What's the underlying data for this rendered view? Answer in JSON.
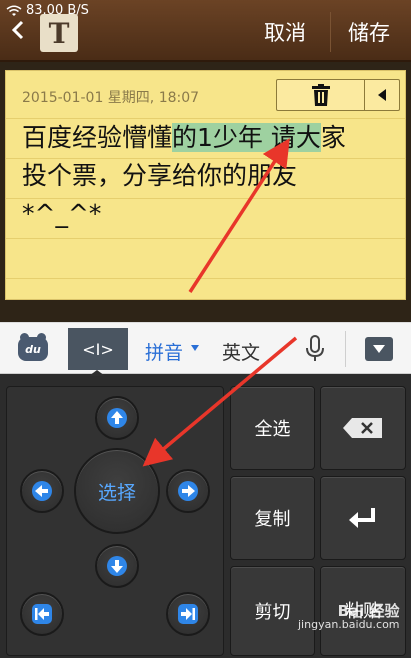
{
  "status_bar": {
    "speed": "83.00 B/S"
  },
  "header": {
    "app_icon_letter": "T",
    "cancel_label": "取消",
    "save_label": "储存"
  },
  "note": {
    "date": "2015-01-01 星期四, 18:07",
    "line1_pre": "百度经验懵懂",
    "line1_selected": "的1少年 请大",
    "line1_post": "家",
    "line2": "投个票，分享给你的朋友",
    "line3": "*^_^*"
  },
  "keyboard_toolbar": {
    "logo_text": "du",
    "cursor_tool_label": "<I>",
    "pinyin_label": "拼音",
    "english_label": "英文"
  },
  "keyboard": {
    "select_label": "选择",
    "select_all_label": "全选",
    "copy_label": "复制",
    "cut_label": "剪切",
    "paste_label": "粘贴"
  },
  "watermark": {
    "logo": "Bai 经验",
    "url": "jingyan.baidu.com"
  },
  "colors": {
    "accent_blue": "#2a6fd6",
    "highlight_green": "#9ed1a0",
    "arrow_red": "#e8362a"
  }
}
